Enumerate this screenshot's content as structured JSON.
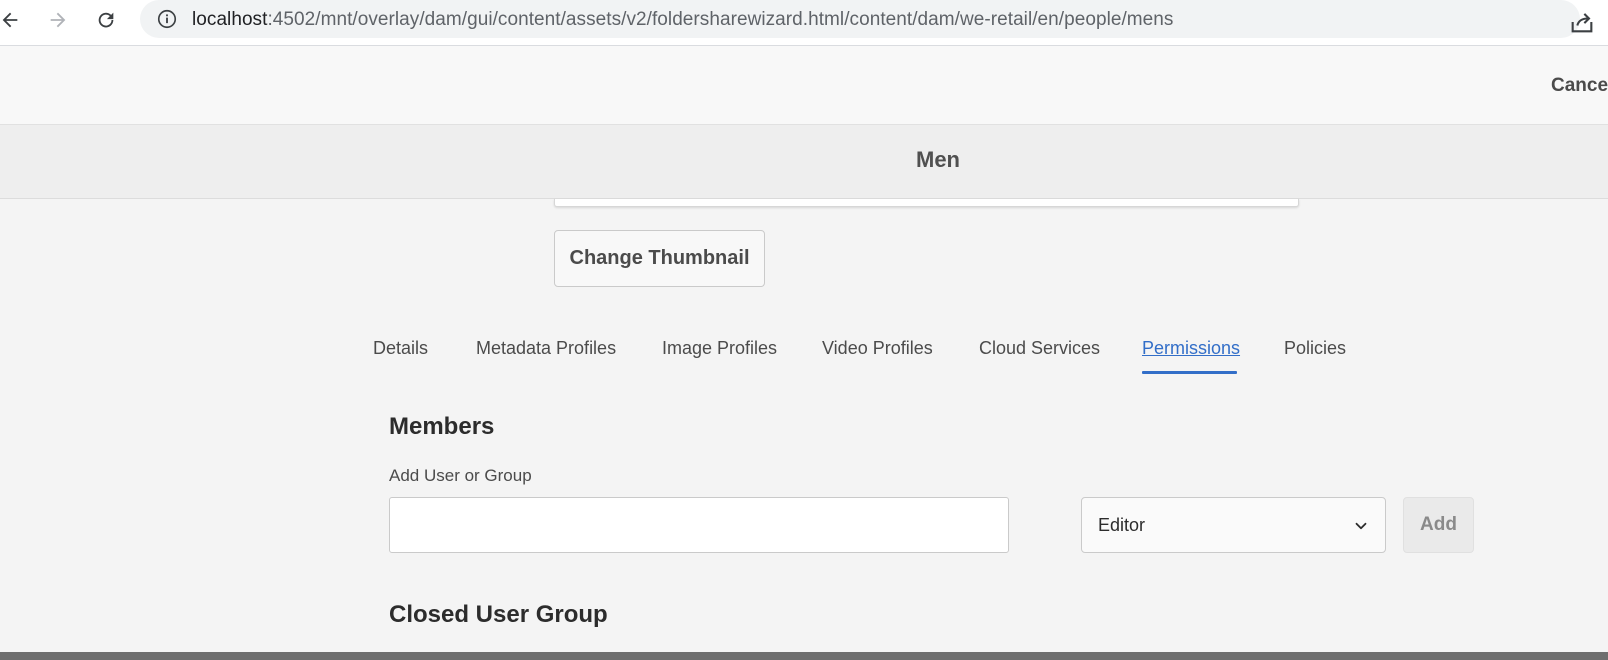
{
  "browser": {
    "url_host": "localhost",
    "url_rest": ":4502/mnt/overlay/dam/gui/content/assets/v2/foldersharewizard.html/content/dam/we-retail/en/people/mens"
  },
  "header": {
    "cancel_label": "Cance"
  },
  "title": "Men",
  "thumbnail": {
    "change_label": "Change Thumbnail"
  },
  "tabs": [
    {
      "label": "Details"
    },
    {
      "label": "Metadata Profiles"
    },
    {
      "label": "Image Profiles"
    },
    {
      "label": "Video Profiles"
    },
    {
      "label": "Cloud Services"
    },
    {
      "label": "Permissions",
      "active": true
    },
    {
      "label": "Policies"
    }
  ],
  "members": {
    "heading": "Members",
    "field_label": "Add User or Group",
    "input_value": "",
    "role_value": "Editor",
    "add_label": "Add"
  },
  "cug": {
    "heading": "Closed User Group"
  },
  "colors": {
    "accent": "#326ec8",
    "background": "#f4f4f4"
  }
}
